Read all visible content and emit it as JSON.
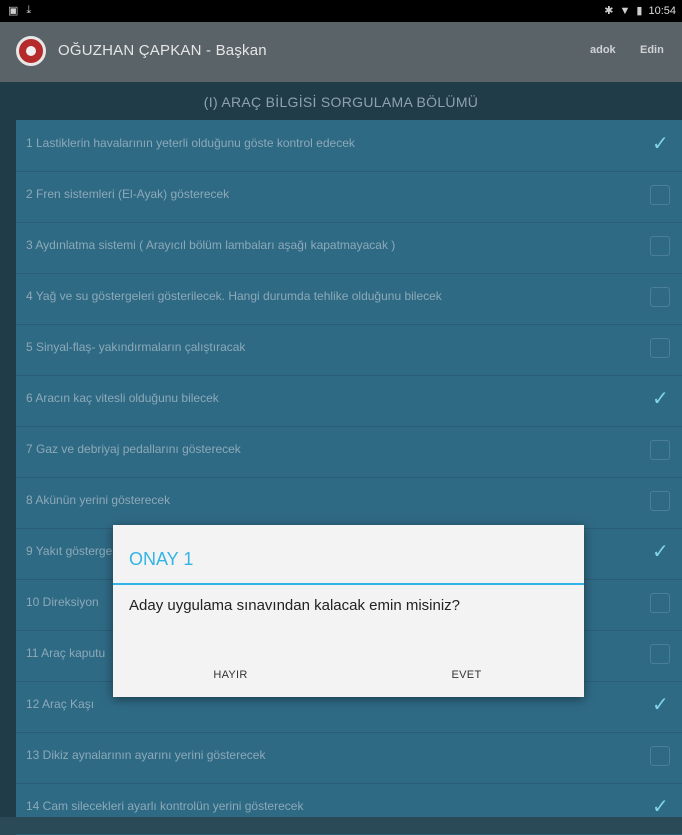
{
  "status_bar": {
    "time": "10:54"
  },
  "app_bar": {
    "title": "OĞUZHAN ÇAPKAN - Başkan",
    "actions": [
      "adok",
      "Edin"
    ]
  },
  "section": {
    "title": "(I) ARAÇ BİLGİSİ SORGULAMA BÖLÜMÜ"
  },
  "items": [
    {
      "label": "1 Lastiklerin havalarının yeterli olduğunu göste kontrol edecek",
      "checked": true
    },
    {
      "label": "2 Fren sistemleri (El-Ayak) gösterecek",
      "checked": false
    },
    {
      "label": "3 Aydınlatma sistemi ( Arayıcıl bölüm lambaları aşağı kapatmayacak )",
      "checked": false
    },
    {
      "label": "4 Yağ ve su göstergeleri gösterilecek. Hangi durumda tehlike olduğunu bilecek",
      "checked": false
    },
    {
      "label": "5 Sinyal-flaş- yakındırmaların çalıştıracak",
      "checked": false
    },
    {
      "label": "6 Aracın kaç vitesli olduğunu bilecek",
      "checked": true
    },
    {
      "label": "7 Gaz ve debriyaj pedallarını gösterecek",
      "checked": false
    },
    {
      "label": "8 Akünün yerini gösterecek",
      "checked": false
    },
    {
      "label": "9 Yakıt göstergesi",
      "checked": true
    },
    {
      "label": "10 Direksiyon",
      "checked": false
    },
    {
      "label": "11 Araç kaputu",
      "checked": false
    },
    {
      "label": "12 Araç Kaşı",
      "checked": true
    },
    {
      "label": "13 Dikiz aynalarının ayarını yerini gösterecek",
      "checked": false
    },
    {
      "label": "14 Cam silecekleri ayarlı kontrolün yerini gösterecek",
      "checked": true
    }
  ],
  "dialog": {
    "title": "ONAY 1",
    "message": "Aday uygulama sınavından kalacak emin misiniz?",
    "negative": "HAYIR",
    "positive": "EVET"
  },
  "colors": {
    "accent": "#32b5e5",
    "list_bg": "#2f6a85",
    "status_bar": "#000000",
    "app_bar": "#5a6368"
  }
}
